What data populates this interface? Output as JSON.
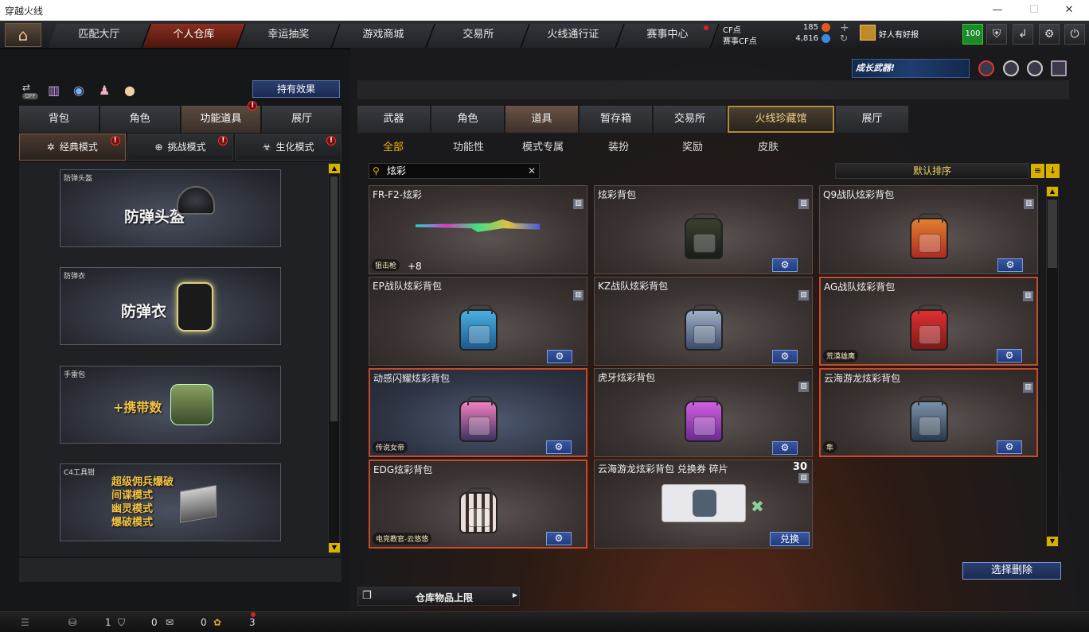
{
  "window": {
    "title": "穿越火线",
    "min": "—",
    "max": "☐",
    "close": "✕"
  },
  "nav": {
    "tabs": [
      "匹配大厅",
      "个人仓库",
      "幸运抽奖",
      "游戏商城",
      "交易所",
      "火线通行证",
      "赛事中心"
    ],
    "active": 1
  },
  "currency": {
    "cf_label": "CF点",
    "cf_value": "185",
    "match_label": "赛事CF点",
    "match_value": "4,816",
    "user": "好人有好报",
    "badge": "100"
  },
  "banner": {
    "text": "成长武器!"
  },
  "left": {
    "hold_button": "持有效果",
    "toggle_off": "OFF",
    "tabs": [
      "背包",
      "角色",
      "功能道具",
      "展厅"
    ],
    "modes": [
      "经典模式",
      "挑战模式",
      "生化模式"
    ],
    "cards": [
      {
        "label": "防弹头盔",
        "big": "防弹头盔"
      },
      {
        "label": "防弹衣",
        "big": "防弹衣"
      },
      {
        "label": "手雷包",
        "big": "+携带数"
      },
      {
        "label": "C4工具钳",
        "lines": [
          "超级佣兵爆破",
          "间谍模式",
          "幽灵模式",
          "爆破模式"
        ]
      }
    ]
  },
  "right": {
    "tabs": [
      "武器",
      "角色",
      "道具",
      "暂存箱",
      "交易所",
      "火线珍藏馆",
      "展厅"
    ],
    "subtabs": [
      "全部",
      "功能性",
      "模式专属",
      "装扮",
      "奖励",
      "皮肤"
    ],
    "search": "炫彩",
    "sort": "默认排序",
    "items": [
      {
        "name": "FR-F2-炫彩",
        "tag": "狙击枪",
        "extra": "+8"
      },
      {
        "name": "炫彩背包"
      },
      {
        "name": "Q9战队炫彩背包"
      },
      {
        "name": "EP战队炫彩背包"
      },
      {
        "name": "KZ战队炫彩背包"
      },
      {
        "name": "AG战队炫彩背包",
        "tag": "荒漠雄鹰"
      },
      {
        "name": "动感闪耀炫彩背包",
        "tag": "传说女帝"
      },
      {
        "name": "虎牙炫彩背包"
      },
      {
        "name": "云海游龙炫彩背包",
        "tag": "隼"
      },
      {
        "name": "EDG炫彩背包",
        "tag": "电竞教官-云悠悠"
      },
      {
        "name": "云海游龙炫彩背包 兑换券 碎片",
        "count": "30",
        "button": "兑换"
      }
    ],
    "delete_button": "选择删除",
    "limit": "仓库物品上限"
  },
  "bottom": {
    "c1": "1",
    "c2": "0",
    "c3": "0",
    "c4": "3"
  },
  "colors": {
    "accent": "#f0b000",
    "active_nav": "#8a2e1e",
    "button_blue": "#203c80",
    "highlight_red": "#c94a2a"
  }
}
